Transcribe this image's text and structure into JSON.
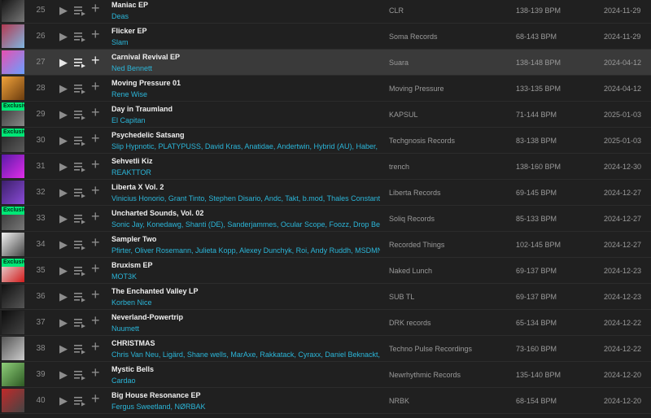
{
  "exclusive_label": "Exclusive",
  "tracks": [
    {
      "num": "25",
      "title": "Maniac EP",
      "artists": "Deas",
      "label": "CLR",
      "bpm": "138-139 BPM",
      "date": "2024-11-29",
      "exclusive": false,
      "art_colors": [
        "#111",
        "#777"
      ]
    },
    {
      "num": "26",
      "title": "Flicker EP",
      "artists": "Slam",
      "label": "Soma Records",
      "bpm": "68-143 BPM",
      "date": "2024-11-29",
      "exclusive": false,
      "art_colors": [
        "#b33a52",
        "#7fb6e0"
      ]
    },
    {
      "num": "27",
      "title": "Carnival Revival EP",
      "artists": "Ned Bennett",
      "label": "Suara",
      "bpm": "138-148 BPM",
      "date": "2024-04-12",
      "exclusive": false,
      "highlight": true,
      "art_colors": [
        "#e84fb0",
        "#6aa0ff"
      ]
    },
    {
      "num": "28",
      "title": "Moving Pressure 01",
      "artists": "Rene Wise",
      "label": "Moving Pressure",
      "bpm": "133-135 BPM",
      "date": "2024-04-12",
      "exclusive": false,
      "art_colors": [
        "#f2a33a",
        "#6b3c0f"
      ]
    },
    {
      "num": "29",
      "title": "Day in Traumland",
      "artists": "El Capitan",
      "label": "KAPSUL",
      "bpm": "71-144 BPM",
      "date": "2025-01-03",
      "exclusive": true,
      "art_colors": [
        "#333",
        "#888"
      ]
    },
    {
      "num": "30",
      "title": "Psychedelic Satsang",
      "artists": "Slip Hypnotic, PLATYPUSS, David Kras, Anatidae, Andertwin, Hybrid (AU), Haber, Med",
      "label": "Techgnosis Records",
      "bpm": "83-138 BPM",
      "date": "2025-01-03",
      "exclusive": true,
      "art_colors": [
        "#222",
        "#5b5b5b"
      ]
    },
    {
      "num": "31",
      "title": "Sehvetli Kiz",
      "artists": "REAKTTOR",
      "label": "trench",
      "bpm": "138-160 BPM",
      "date": "2024-12-30",
      "exclusive": false,
      "art_colors": [
        "#5a1aa8",
        "#e02de8"
      ]
    },
    {
      "num": "32",
      "title": "Liberta X Vol. 2",
      "artists": "Vinicius Honorio, Grant Tinto, Stephen Disario, Andc, Takt, b.mod, Thales Constantini, J",
      "label": "Liberta Records",
      "bpm": "69-145 BPM",
      "date": "2024-12-27",
      "exclusive": false,
      "art_colors": [
        "#3b1f6b",
        "#8a4bd6"
      ]
    },
    {
      "num": "33",
      "title": "Uncharted Sounds, Vol. 02",
      "artists": "Sonic Jay, Konedawg, Shanti (DE), Sanderjammes, Ocular Scope, Foozz, Drop Bear, N",
      "label": "Soliq Records",
      "bpm": "85-133 BPM",
      "date": "2024-12-27",
      "exclusive": true,
      "art_colors": [
        "#333",
        "#777"
      ]
    },
    {
      "num": "34",
      "title": "Sampler Two",
      "artists": "Pfirter, Oliver Rosemann, Julieta Kopp, Alexey Dunchyk, Roi, Andy Ruddh, MSDMNR, J",
      "label": "Recorded Things",
      "bpm": "102-145 BPM",
      "date": "2024-12-27",
      "exclusive": false,
      "art_colors": [
        "#f2f2f2",
        "#444"
      ]
    },
    {
      "num": "35",
      "title": "Bruxism EP",
      "artists": "MOT3K",
      "label": "Naked Lunch",
      "bpm": "69-137 BPM",
      "date": "2024-12-23",
      "exclusive": true,
      "art_colors": [
        "#e8e8e8",
        "#d21c1c"
      ]
    },
    {
      "num": "36",
      "title": "The Enchanted Valley LP",
      "artists": "Korben Nice",
      "label": "SUB TL",
      "bpm": "69-137 BPM",
      "date": "2024-12-23",
      "exclusive": false,
      "art_colors": [
        "#111",
        "#555"
      ]
    },
    {
      "num": "37",
      "title": "Neverland-Powertrip",
      "artists": "Nuumett",
      "label": "DRK records",
      "bpm": "65-134 BPM",
      "date": "2024-12-22",
      "exclusive": false,
      "art_colors": [
        "#0c0c0c",
        "#444"
      ]
    },
    {
      "num": "38",
      "title": "CHRISTMAS",
      "artists": "Chris Van Neu, Ligärd, Shane wells, MarAxe, Rakkatack, Cyraxx, Daniel Beknackt, DO",
      "label": "Techno Pulse Recordings",
      "bpm": "73-160 BPM",
      "date": "2024-12-22",
      "exclusive": false,
      "art_colors": [
        "#555",
        "#ccc"
      ]
    },
    {
      "num": "39",
      "title": "Mystic Bells",
      "artists": "Cardao",
      "label": "Newrhythmic Records",
      "bpm": "135-140 BPM",
      "date": "2024-12-20",
      "exclusive": false,
      "art_colors": [
        "#8fcf7a",
        "#2d5a23"
      ]
    },
    {
      "num": "40",
      "title": "Big House Resonance EP",
      "artists": "Fergus Sweetland, NØRBAK",
      "label": "NRBK",
      "bpm": "68-154 BPM",
      "date": "2024-12-20",
      "exclusive": false,
      "art_colors": [
        "#c22a2a",
        "#444"
      ]
    }
  ]
}
